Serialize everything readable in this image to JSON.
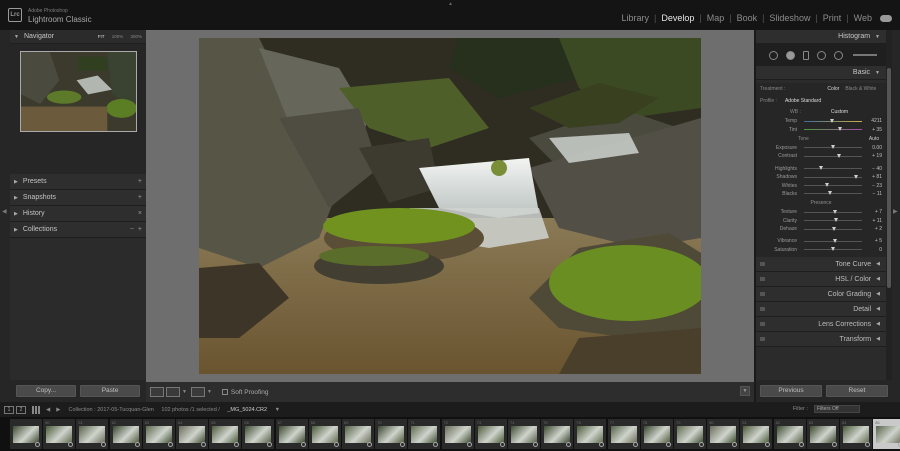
{
  "app": {
    "vendor": "Adobe Photoshop",
    "name": "Lightroom Classic",
    "logo": "Lrc"
  },
  "modules": [
    "Library",
    "Develop",
    "Map",
    "Book",
    "Slideshow",
    "Print",
    "Web"
  ],
  "active_module": "Develop",
  "left": {
    "navigator": {
      "title": "Navigator",
      "zoom_options": [
        "FIT",
        "100%",
        "300%"
      ],
      "zoom_selected": "FIT"
    },
    "sections": [
      {
        "title": "Presets",
        "control": "+"
      },
      {
        "title": "Snapshots",
        "control": "+"
      },
      {
        "title": "History",
        "control": "×"
      },
      {
        "title": "Collections",
        "control": "+"
      }
    ],
    "copy_label": "Copy...",
    "paste_label": "Paste"
  },
  "toolbar": {
    "soft_proofing": "Soft Proofing"
  },
  "right": {
    "histogram_title": "Histogram",
    "basic": {
      "title": "Basic",
      "treatment_label": "Treatment :",
      "treatment_color": "Color",
      "treatment_bw": "Black & White",
      "profile_label": "Profile :",
      "profile_value": "Adobe Standard",
      "wb_label": "WB :",
      "wb_value": "Custom",
      "temp": {
        "label": "Temp",
        "value": "4211",
        "pos": 0.48
      },
      "tint": {
        "label": "Tint",
        "value": "+ 35",
        "pos": 0.62
      },
      "tone_label": "Tone",
      "auto_label": "Auto",
      "tone": [
        {
          "label": "Exposure",
          "value": "0.00",
          "pos": 0.5
        },
        {
          "label": "Contrast",
          "value": "+ 19",
          "pos": 0.6
        },
        {
          "label": "Highlights",
          "value": "− 40",
          "pos": 0.3
        },
        {
          "label": "Shadows",
          "value": "+ 81",
          "pos": 0.9
        },
        {
          "label": "Whites",
          "value": "− 23",
          "pos": 0.39
        },
        {
          "label": "Blacks",
          "value": "− 11",
          "pos": 0.45
        }
      ],
      "presence_label": "Presence",
      "presence": [
        {
          "label": "Texture",
          "value": "+ 7",
          "pos": 0.54
        },
        {
          "label": "Clarity",
          "value": "+ 11",
          "pos": 0.56
        },
        {
          "label": "Dehaze",
          "value": "+ 2",
          "pos": 0.51
        },
        {
          "label": "Vibrance",
          "value": "+ 5",
          "pos": 0.53
        },
        {
          "label": "Saturation",
          "value": "0",
          "pos": 0.5
        }
      ]
    },
    "sections": [
      "Tone Curve",
      "HSL / Color",
      "Color Grading",
      "Detail",
      "Lens Corrections"
    ],
    "partial_section": "Transform",
    "previous_label": "Previous",
    "reset_label": "Reset"
  },
  "filmstrip": {
    "page_1": "1",
    "page_2": "2",
    "collection": "Collection : 2017-05-Tucquan-Glen",
    "count": "102 photos /1 selected /",
    "file": "_MG_5024.CR2",
    "filter_label": "Filter :",
    "filter_value": "Filters Off",
    "thumbs": [
      "",
      "60",
      "61",
      "62",
      "63",
      "64",
      "65",
      "66",
      "67",
      "68",
      "69",
      "70",
      "71",
      "72",
      "73",
      "74",
      "75",
      "76",
      "77",
      "78",
      "79",
      "80",
      "81",
      "82",
      "83",
      "84",
      "85",
      "86"
    ],
    "selected_index": 26
  },
  "colors": {
    "accent": "#e6e6e6",
    "panel": "#2b2b2b",
    "canvas": "#6e6e6e"
  }
}
